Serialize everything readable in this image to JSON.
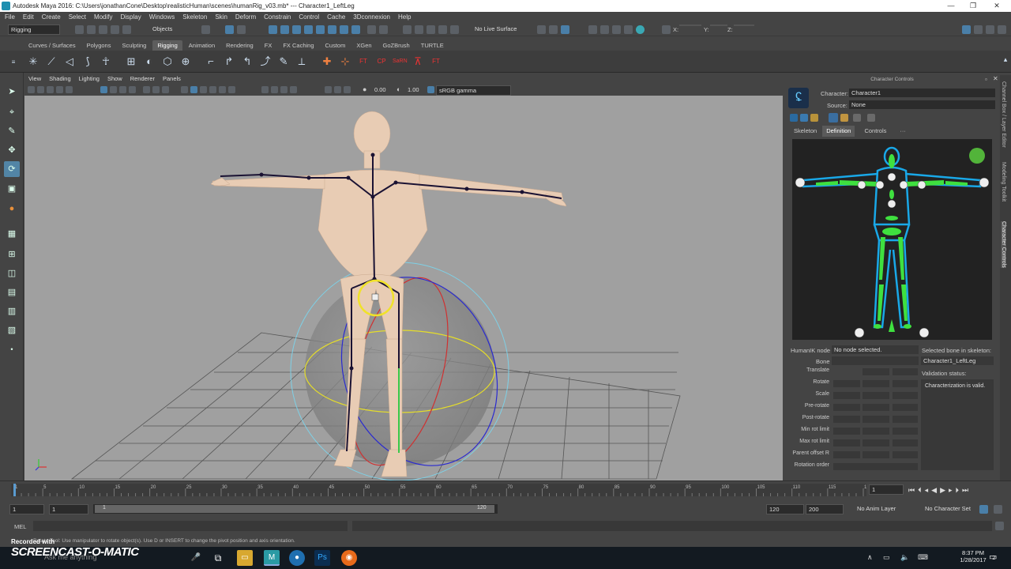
{
  "title": {
    "text": "Autodesk Maya 2016: C:\\Users\\jonathanCone\\Desktop\\realisticHuman\\scenes\\humanRig_v03.mb*  ---  Character1_LeftLeg"
  },
  "window_controls": {
    "minimize": "—",
    "restore": "❐",
    "close": "✕"
  },
  "menubar": [
    "File",
    "Edit",
    "Create",
    "Select",
    "Modify",
    "Display",
    "Windows",
    "Skeleton",
    "Skin",
    "Deform",
    "Constrain",
    "Control",
    "Cache",
    "3Dconnexion",
    "Help"
  ],
  "statusline": {
    "menuset": "Rigging",
    "selmode": "Objects",
    "live_surface": "No Live Surface",
    "x_label": "X:",
    "y_label": "Y:",
    "z_label": "Z:"
  },
  "shelf_tabs": [
    {
      "label": "Curves / Surfaces",
      "active": false
    },
    {
      "label": "Polygons",
      "active": false
    },
    {
      "label": "Sculpting",
      "active": false
    },
    {
      "label": "Rigging",
      "active": true
    },
    {
      "label": "Animation",
      "active": false
    },
    {
      "label": "Rendering",
      "active": false
    },
    {
      "label": "FX",
      "active": false
    },
    {
      "label": "FX Caching",
      "active": false
    },
    {
      "label": "Custom",
      "active": false
    },
    {
      "label": "XGen",
      "active": false
    },
    {
      "label": "GoZBrush",
      "active": false
    },
    {
      "label": "TURTLE",
      "active": false
    }
  ],
  "shelf_icon_labels": [
    "FT",
    "CP",
    "SaRN",
    "FT"
  ],
  "panel_menu": [
    "View",
    "Shading",
    "Lighting",
    "Show",
    "Renderer",
    "Panels"
  ],
  "panel_bar": {
    "exposure": "0.00",
    "gamma": "1.00",
    "colorspace": "sRGB gamma"
  },
  "character_controls": {
    "header": "Character Controls",
    "character_label": "Character:",
    "character_value": "Character1",
    "source_label": "Source:",
    "source_value": "None",
    "tabs": [
      {
        "label": "Skeleton",
        "active": false
      },
      {
        "label": "Definition",
        "active": true
      },
      {
        "label": "Controls",
        "active": false
      },
      {
        "label": "···",
        "active": false
      }
    ],
    "humanik_label": "HumanIK node",
    "humanik_value": "No node selected.",
    "selected_bone_label": "Selected bone in skeleton:",
    "selected_bone_value": "Character1_LeftLeg",
    "bone_label": "Bone",
    "validation_label": "Validation status:",
    "validation_value": "Characterization is valid.",
    "rows": [
      "Translate",
      "Rotate",
      "Scale",
      "Pre-rotate",
      "Post-rotate",
      "Min rot limit",
      "Max rot limit",
      "Parent offset R",
      "Rotation order"
    ]
  },
  "side_tabs": [
    "Channel Box / Layer Editor",
    "Modeling Toolkit",
    "Character Controls"
  ],
  "timeline": {
    "ticks": [
      "1",
      "5",
      "10",
      "15",
      "20",
      "25",
      "30",
      "35",
      "40",
      "45",
      "50",
      "55",
      "60",
      "65",
      "70",
      "75",
      "80",
      "85",
      "90",
      "95",
      "100",
      "105",
      "110",
      "115",
      "120"
    ],
    "current_frame": "1"
  },
  "range": {
    "start": "1",
    "inner_start": "1",
    "slider_start": "1",
    "slider_end": "120",
    "end": "120",
    "anim_end": "200",
    "anim_layer": "No Anim Layer",
    "char_set": "No Character Set"
  },
  "mel": {
    "label": "MEL"
  },
  "helpline": "Rotate Tool: Use manipulator to rotate object(s). Use D or INSERT to change the pivot position and axis orientation.",
  "watermark": {
    "recorded": "Recorded with",
    "brand": "SCREENCAST-O-MATIC"
  },
  "taskbar": {
    "search": "Ask me anything",
    "time": "8:37 PM",
    "date": "1/28/2017",
    "notifications": "2"
  }
}
